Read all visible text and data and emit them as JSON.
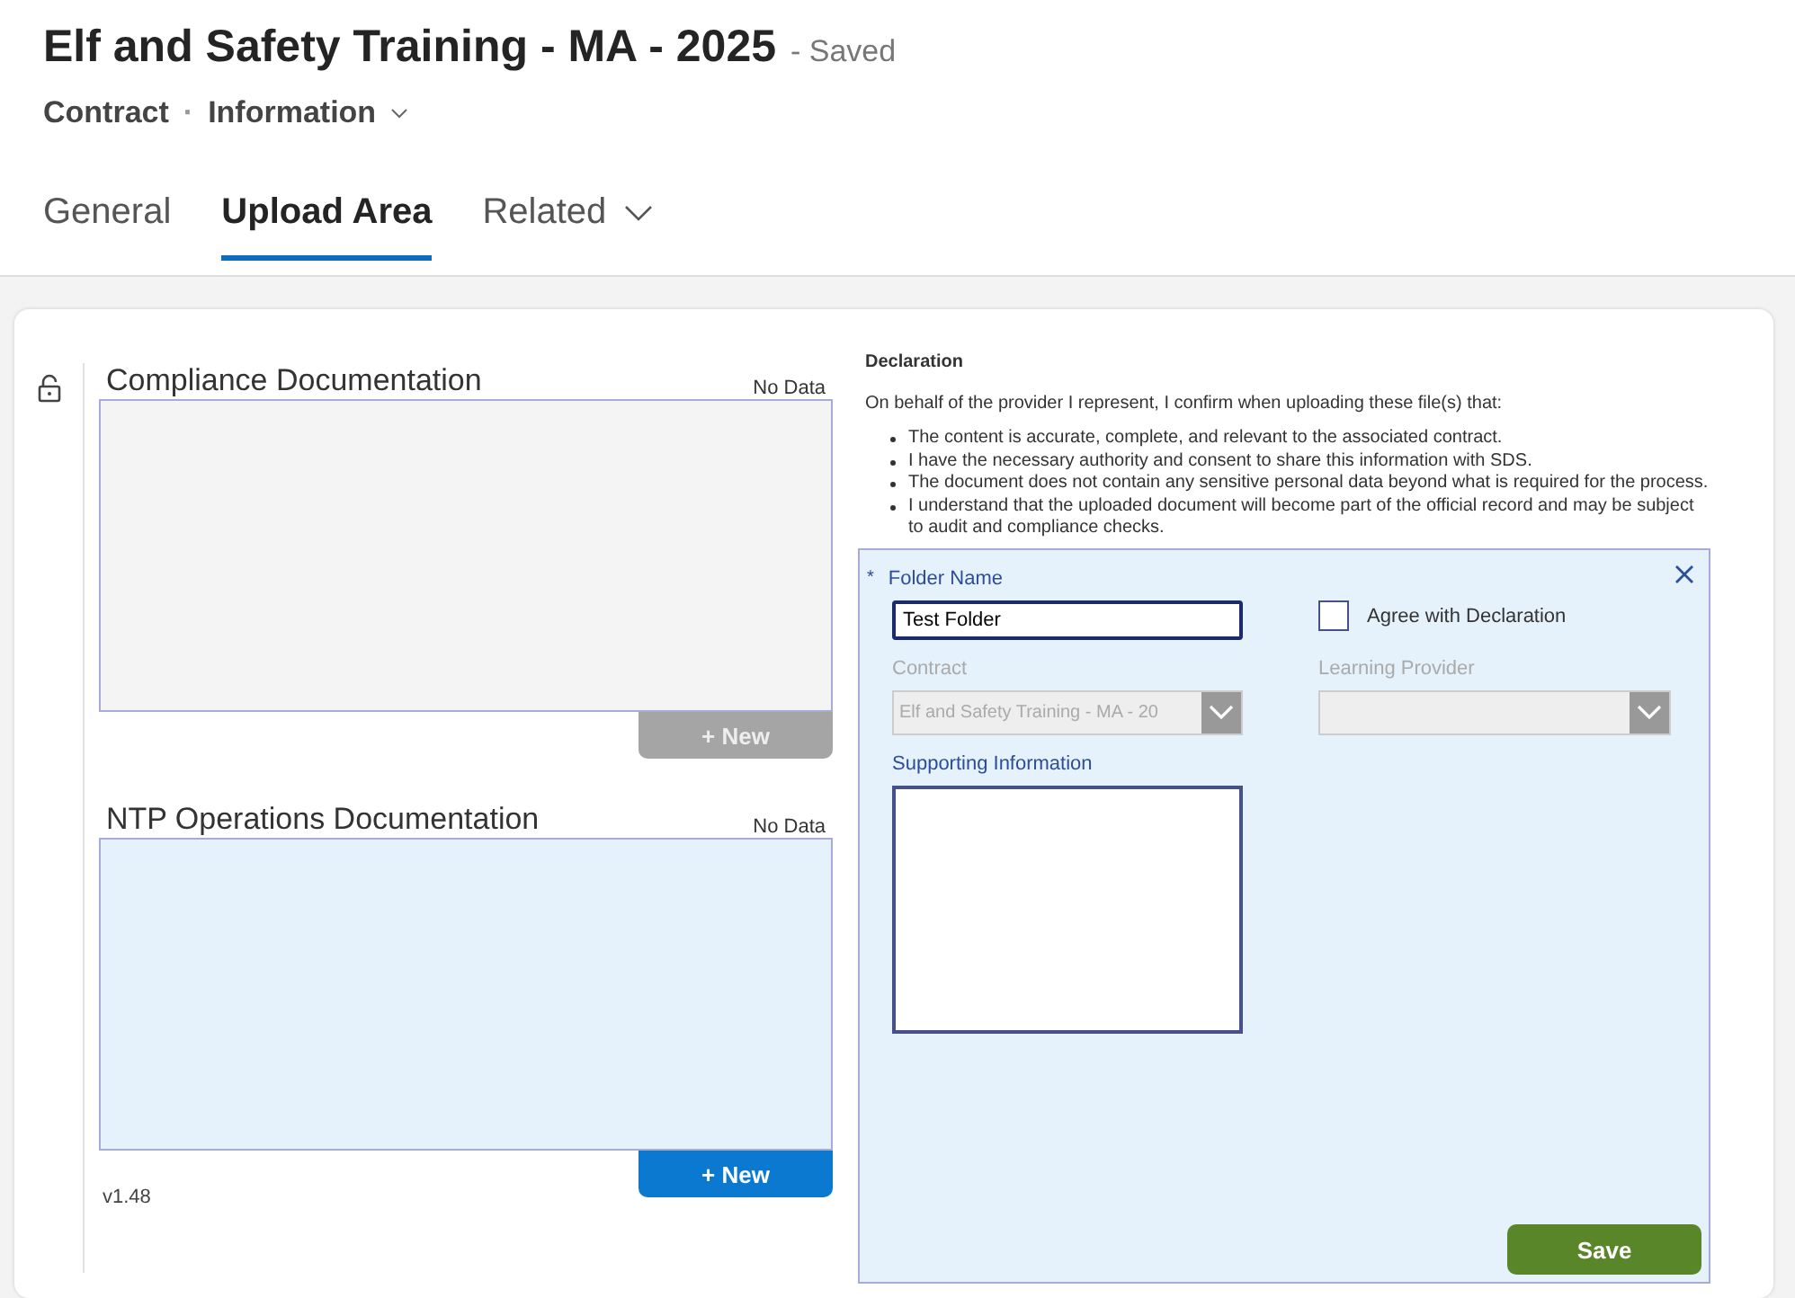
{
  "header": {
    "title": "Elf and Safety Training - MA - 2025",
    "save_status": "- Saved",
    "entity": "Contract",
    "separator": "·",
    "form_selector": "Information"
  },
  "tabs": [
    {
      "label": "General",
      "selected": false,
      "dropdown": false
    },
    {
      "label": "Upload Area",
      "selected": true,
      "dropdown": false
    },
    {
      "label": "Related",
      "selected": false,
      "dropdown": true
    }
  ],
  "panels": [
    {
      "title": "Compliance Documentation",
      "status": "No Data",
      "button": "+ New",
      "disabled": true
    },
    {
      "title": "NTP Operations Documentation",
      "status": "No Data",
      "button": "+ New",
      "disabled": false
    }
  ],
  "version": "v1.48",
  "declaration": {
    "heading": "Declaration",
    "intro": "On behalf of the provider I represent, I confirm when uploading these file(s) that:",
    "points": [
      "The content is accurate, complete, and relevant to the associated contract.",
      "I have the necessary authority and consent to share this information with SDS.",
      "The document does not contain any sensitive personal data beyond what is required for the process.",
      "I understand that the uploaded document will become part of the official record and may be subject to audit and compliance checks."
    ]
  },
  "form": {
    "required_mark": "*",
    "folder_label": "Folder Name",
    "folder_value": "Test Folder",
    "agree": {
      "label": "Agree with Declaration",
      "checked": false
    },
    "contract": {
      "label": "Contract",
      "value": "Elf and Safety Training - MA - 20",
      "disabled": true
    },
    "provider": {
      "label": "Learning Provider",
      "disabled": true
    },
    "supporting_label": "Supporting Information",
    "save": "Save"
  }
}
